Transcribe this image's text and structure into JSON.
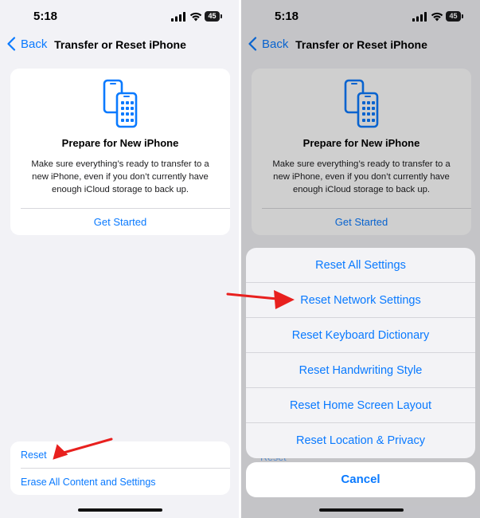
{
  "status_bar": {
    "time": "5:18",
    "battery": "45"
  },
  "nav": {
    "back_label": "Back",
    "title": "Transfer or Reset iPhone"
  },
  "card": {
    "title": "Prepare for New iPhone",
    "description": "Make sure everything’s ready to transfer to a new iPhone, even if you don’t currently have enough iCloud storage to back up.",
    "action": "Get Started"
  },
  "bottom_group": {
    "reset": "Reset",
    "erase": "Erase All Content and Settings"
  },
  "action_sheet": {
    "options": [
      "Reset All Settings",
      "Reset Network Settings",
      "Reset Keyboard Dictionary",
      "Reset Handwriting Style",
      "Reset Home Screen Layout",
      "Reset Location & Privacy"
    ],
    "cancel": "Cancel",
    "peek_text": "Reset"
  },
  "colors": {
    "accent": "#0a7aff",
    "annotation_arrow": "#e8201e",
    "background": "#f2f2f6"
  }
}
